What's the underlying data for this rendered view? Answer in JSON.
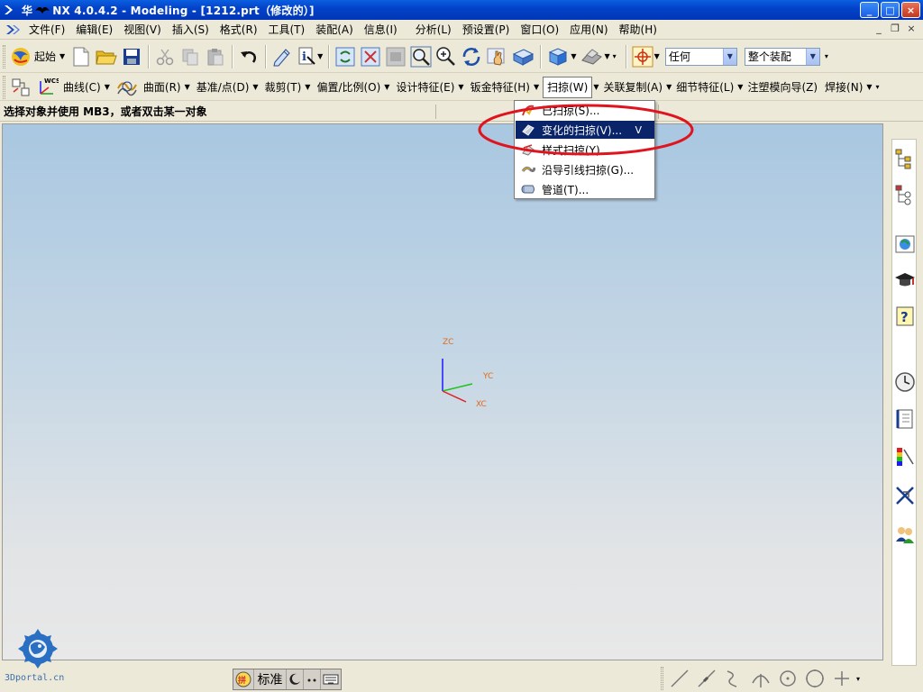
{
  "window": {
    "title_prefix": "华",
    "title": "NX 4.0.4.2 - Modeling - [1212.prt（修改的）]",
    "minimize": "_",
    "maximize": "□",
    "close": "×"
  },
  "menubar": {
    "items": [
      {
        "label": "文件(F)"
      },
      {
        "label": "编辑(E)"
      },
      {
        "label": "视图(V)"
      },
      {
        "label": "插入(S)"
      },
      {
        "label": "格式(R)"
      },
      {
        "label": "工具(T)"
      },
      {
        "label": "装配(A)"
      },
      {
        "label": "信息(I)"
      },
      {
        "label": "分析(L)"
      },
      {
        "label": "预设置(P)"
      },
      {
        "label": "窗口(O)"
      },
      {
        "label": "应用(N)"
      },
      {
        "label": "帮助(H)"
      }
    ],
    "mdi_minimize": "_",
    "mdi_restore": "❐",
    "mdi_close": "×"
  },
  "toolbar1": {
    "start_label": "起始",
    "filter_value": "任何",
    "assembly_value": "整个装配"
  },
  "toolbar2": {
    "wcs_label": "WCS",
    "curve_label": "曲线(C)",
    "surface_label": "曲面(R)",
    "datum_label": "基准/点(D)",
    "trim_label": "裁剪(T)",
    "offset_label": "偏置/比例(O)",
    "design_feature_label": "设计特征(E)",
    "sheet_metal_label": "钣金特征(H)",
    "sweep_label": "扫掠(W)",
    "assoc_copy_label": "关联复制(A)",
    "detail_feature_label": "细节特征(L)",
    "mold_wizard_label": "注塑模向导(Z)",
    "weld_label": "焊接(N)"
  },
  "cue": {
    "text": "选择对象并使用 MB3，或者双击某一对象"
  },
  "sweep_menu": {
    "items": [
      {
        "label": "已扫掠(S)...",
        "accel": ""
      },
      {
        "label": "变化的扫掠(V)...",
        "accel": "V"
      },
      {
        "label": "样式扫掠(Y)...",
        "accel": ""
      },
      {
        "label": "沿导引线扫掠(G)...",
        "accel": ""
      },
      {
        "label": "管道(T)...",
        "accel": ""
      }
    ],
    "selected_index": 1
  },
  "triad": {
    "zc": "ZC",
    "yc": "YC",
    "xc": "XC"
  },
  "watermark": "3Dportal.cn",
  "ime": {
    "mode": "标准"
  },
  "colors": {
    "titlebar": "#0343c9",
    "selection": "#0a246a",
    "highlight_ellipse": "#e0141e",
    "axis_z": "#1a1aff",
    "axis_y": "#19c319",
    "axis_x": "#e02020",
    "axis_label": "#e06a1a"
  }
}
